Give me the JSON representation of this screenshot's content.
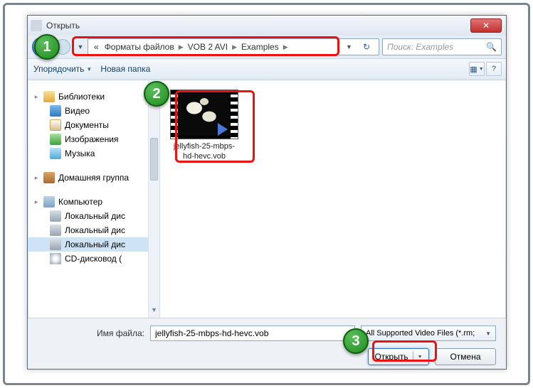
{
  "window": {
    "title": "Открыть",
    "close": "✕"
  },
  "nav": {
    "crumbs": [
      "«",
      "Форматы файлов",
      "VOB 2 AVI",
      "Examples"
    ],
    "search_placeholder": "Поиск: Examples"
  },
  "toolbar": {
    "organize": "Упорядочить",
    "newfolder": "Новая папка"
  },
  "tree": {
    "libraries": "Библиотеки",
    "video": "Видео",
    "documents": "Документы",
    "images": "Изображения",
    "music": "Музыка",
    "homegroup": "Домашняя группа",
    "computer": "Компьютер",
    "localdisk1": "Локальный дис",
    "localdisk2": "Локальный дис",
    "localdisk3": "Локальный дис",
    "cddrive": "CD-дисковод ("
  },
  "file": {
    "name": "jellyfish-25-mbps-hd-hevc.vob"
  },
  "bottom": {
    "filename_label": "Имя файла:",
    "filename_value": "jellyfish-25-mbps-hd-hevc.vob",
    "filter": "All Supported Video Files (*.rm;",
    "open": "Открыть",
    "cancel": "Отмена"
  },
  "ann": {
    "a1": "1",
    "a2": "2",
    "a3": "3"
  }
}
